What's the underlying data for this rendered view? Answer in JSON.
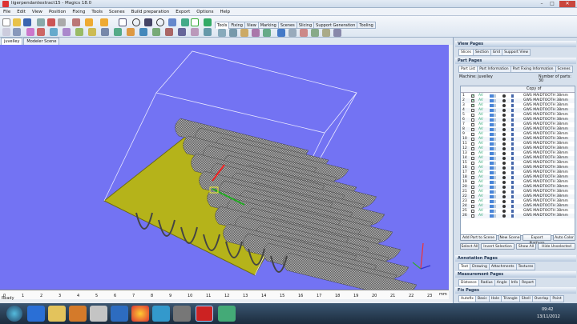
{
  "window": {
    "title": "ligerpendantextract15 - Magics 18.0",
    "min": "–",
    "max": "□",
    "close": "✕"
  },
  "menu": [
    "File",
    "Edit",
    "View",
    "Position",
    "Fixing",
    "Tools",
    "Scenes",
    "Build preparation",
    "Export",
    "Options",
    "Help"
  ],
  "ribbon_tabs": [
    "Tools",
    "Fixing",
    "View",
    "Marking",
    "Scenes",
    "Slicing",
    "Support Generation",
    "Tooling"
  ],
  "scene_tabs": [
    "juvelley",
    "Modeler Scene"
  ],
  "ruler_labels": [
    "0",
    "1",
    "2",
    "3",
    "4",
    "5",
    "6",
    "7",
    "8",
    "9",
    "10",
    "11",
    "12",
    "13",
    "14",
    "15",
    "16",
    "17",
    "18",
    "19",
    "20",
    "21",
    "22",
    "23"
  ],
  "ruler_unit": "mm",
  "status": "Ready",
  "panel": {
    "view_pages": "View Pages",
    "view_tabs": [
      "Slices",
      "Section",
      "Grid",
      "Support View"
    ],
    "part_pages": "Part Pages",
    "part_tabs": [
      "Part List",
      "Part Information",
      "Part Fixing Information",
      "Scenes"
    ],
    "machine_label": "Machine: juvelley",
    "parts_count": "Number of parts: 30",
    "col_copy": "Copy of",
    "rows": [
      {
        "n": "1",
        "checked": true,
        "lf": "AV",
        "name": "GWS MAIDTOOTH 38mm"
      },
      {
        "n": "2",
        "checked": true,
        "lf": "AV",
        "name": "GWS MAIDTOOTH 38mm"
      },
      {
        "n": "3",
        "checked": true,
        "lf": "AV",
        "name": "GWS MAIDTOOTH 38mm"
      },
      {
        "n": "4",
        "checked": false,
        "lf": "AV",
        "name": "GWS MAIDTOOTH 38mm"
      },
      {
        "n": "5",
        "checked": false,
        "lf": "AV",
        "name": "GWS MAIDTOOTH 38mm"
      },
      {
        "n": "6",
        "checked": false,
        "lf": "AV",
        "name": "GWS MAIDTOOTH 38mm"
      },
      {
        "n": "7",
        "checked": false,
        "lf": "AV",
        "name": "GWS MAIDTOOTH 38mm"
      },
      {
        "n": "8",
        "checked": false,
        "lf": "AV",
        "name": "GWS MAIDTOOTH 38mm"
      },
      {
        "n": "9",
        "checked": false,
        "lf": "AV",
        "name": "GWS MAIDTOOTH 38mm"
      },
      {
        "n": "10",
        "checked": false,
        "lf": "AV",
        "name": "GWS MAIDTOOTH 38mm"
      },
      {
        "n": "11",
        "checked": false,
        "lf": "AV",
        "name": "GWS MAIDTOOTH 38mm"
      },
      {
        "n": "12",
        "checked": false,
        "lf": "AV",
        "name": "GWS MAIDTOOTH 38mm"
      },
      {
        "n": "13",
        "checked": false,
        "lf": "AV",
        "name": "GWS MAIDTOOTH 38mm"
      },
      {
        "n": "14",
        "checked": false,
        "lf": "AV",
        "name": "GWS MAIDTOOTH 38mm"
      },
      {
        "n": "15",
        "checked": false,
        "lf": "AV",
        "name": "GWS MAIDTOOTH 38mm"
      },
      {
        "n": "16",
        "checked": false,
        "lf": "AV",
        "name": "GWS MAIDTOOTH 38mm"
      },
      {
        "n": "17",
        "checked": false,
        "lf": "AV",
        "name": "GWS MAIDTOOTH 38mm"
      },
      {
        "n": "18",
        "checked": false,
        "lf": "AV",
        "name": "GWS MAIDTOOTH 38mm"
      },
      {
        "n": "19",
        "checked": false,
        "lf": "AV",
        "name": "GWS MAIDTOOTH 38mm"
      },
      {
        "n": "20",
        "checked": false,
        "lf": "AV",
        "name": "GWS MAIDTOOTH 38mm"
      },
      {
        "n": "21",
        "checked": false,
        "lf": "AV",
        "name": "GWS MAIDTOOTH 38mm"
      },
      {
        "n": "22",
        "checked": false,
        "lf": "AV",
        "name": "GWS MAIDTOOTH 38mm"
      },
      {
        "n": "23",
        "checked": false,
        "lf": "AV",
        "name": "GWS MAIDTOOTH 38mm"
      },
      {
        "n": "24",
        "checked": false,
        "lf": "AV",
        "name": "GWS MAIDTOOTH 38mm"
      },
      {
        "n": "25",
        "checked": false,
        "lf": "AV",
        "name": "GWS MAIDTOOTH 38mm"
      },
      {
        "n": "26",
        "checked": false,
        "lf": "AV",
        "name": "GWS MAIDTOOTH 38mm"
      }
    ],
    "btns1": [
      "Add Part to Scene",
      "New Scene",
      "Export Platform",
      "Auto Color"
    ],
    "btns2": [
      "Select All",
      "Invert Selection",
      "Show All",
      "Hide Unselected"
    ],
    "annotation_pages": "Annotation Pages",
    "annotation_tabs": [
      "Text",
      "Drawing",
      "Attachments",
      "Textures"
    ],
    "measurement_pages": "Measurement Pages",
    "measurement_tabs": [
      "Distance",
      "Radius",
      "Angle",
      "Info",
      "Report"
    ],
    "fix_pages": "Fix Pages",
    "fix_tabs": [
      "Autofix",
      "Basic",
      "Hole",
      "Triangle",
      "Shell",
      "Overlap",
      "Point"
    ]
  },
  "clock": {
    "time": "09:42",
    "date": "13/11/2012"
  },
  "colors": {
    "viewport": "#7373f3",
    "platform": "#b5b31a",
    "accent": "#e33"
  }
}
